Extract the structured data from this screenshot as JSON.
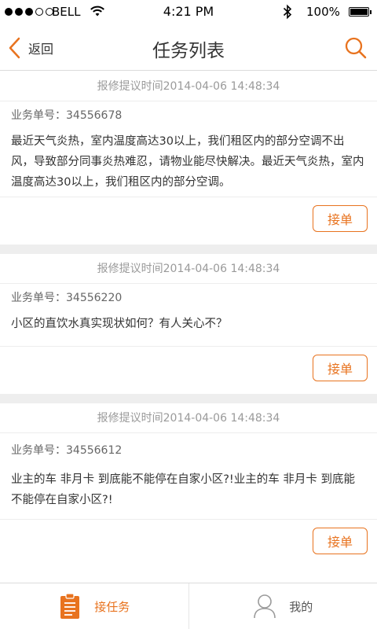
{
  "status_bar": {
    "carrier": "BELL",
    "time": "4:21 PM",
    "battery": "100%"
  },
  "nav": {
    "back_label": "返回",
    "title": "任务列表"
  },
  "tasks": [
    {
      "time_label": "报修提议时间2014-04-06  14:48:34",
      "number_label": "业务单号：34556678",
      "content": "最近天气炎热，室内温度高达30以上，我们租区内的部分空调不出风，导致部分同事炎热难忍，请物业能尽快解决。最近天气炎热，室内温度高达30以上，我们租区内的部分空调。",
      "accept_label": "接单"
    },
    {
      "time_label": "报修提议时间2014-04-06  14:48:34",
      "number_label": "业务单号：34556220",
      "content": "小区的直饮水真实现状如何？有人关心不？",
      "accept_label": "接单"
    },
    {
      "time_label": "报修提议时间2014-04-06  14:48:34",
      "number_label": "业务单号：34556612",
      "content": "业主的车 非月卡 到底能不能停在自家小区?!业主的车 非月卡 到底能不能停在自家小区?!",
      "accept_label": "接单"
    }
  ],
  "tab_bar": {
    "tabs": [
      {
        "label": "接任务",
        "icon": "clipboard-icon",
        "active": true
      },
      {
        "label": "我的",
        "icon": "user-icon",
        "active": false
      }
    ]
  },
  "colors": {
    "accent": "#e8731f",
    "divider": "#eeeeee"
  }
}
